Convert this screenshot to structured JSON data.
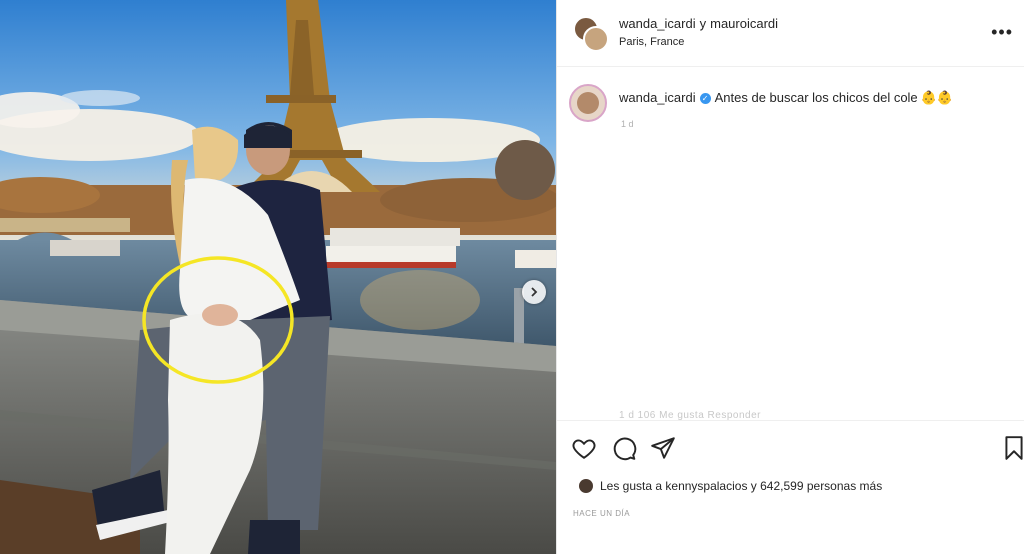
{
  "header": {
    "user1": "wanda_icardi",
    "conjunction": "y",
    "user2": "mauroicardi",
    "location": "Paris, France",
    "more_icon": "more-horizontal-icon"
  },
  "caption": {
    "username": "wanda_icardi",
    "text": "Antes de buscar los chicos del cole",
    "emoji": "👶👶",
    "time": "1 d",
    "cut_meta": "1 d   106 Me gusta   Responder"
  },
  "actions": {
    "icons": [
      "heart-icon",
      "comment-icon",
      "share-icon",
      "bookmark-icon"
    ]
  },
  "likes": {
    "prefix": "Les gusta a",
    "user": "kennyspalacios",
    "suffix": "y 642,599 personas más"
  },
  "posted": "HACE UN DÍA",
  "colors": {
    "highlight_circle": "#f5e625",
    "verified": "#3897f0",
    "text": "#262626"
  }
}
